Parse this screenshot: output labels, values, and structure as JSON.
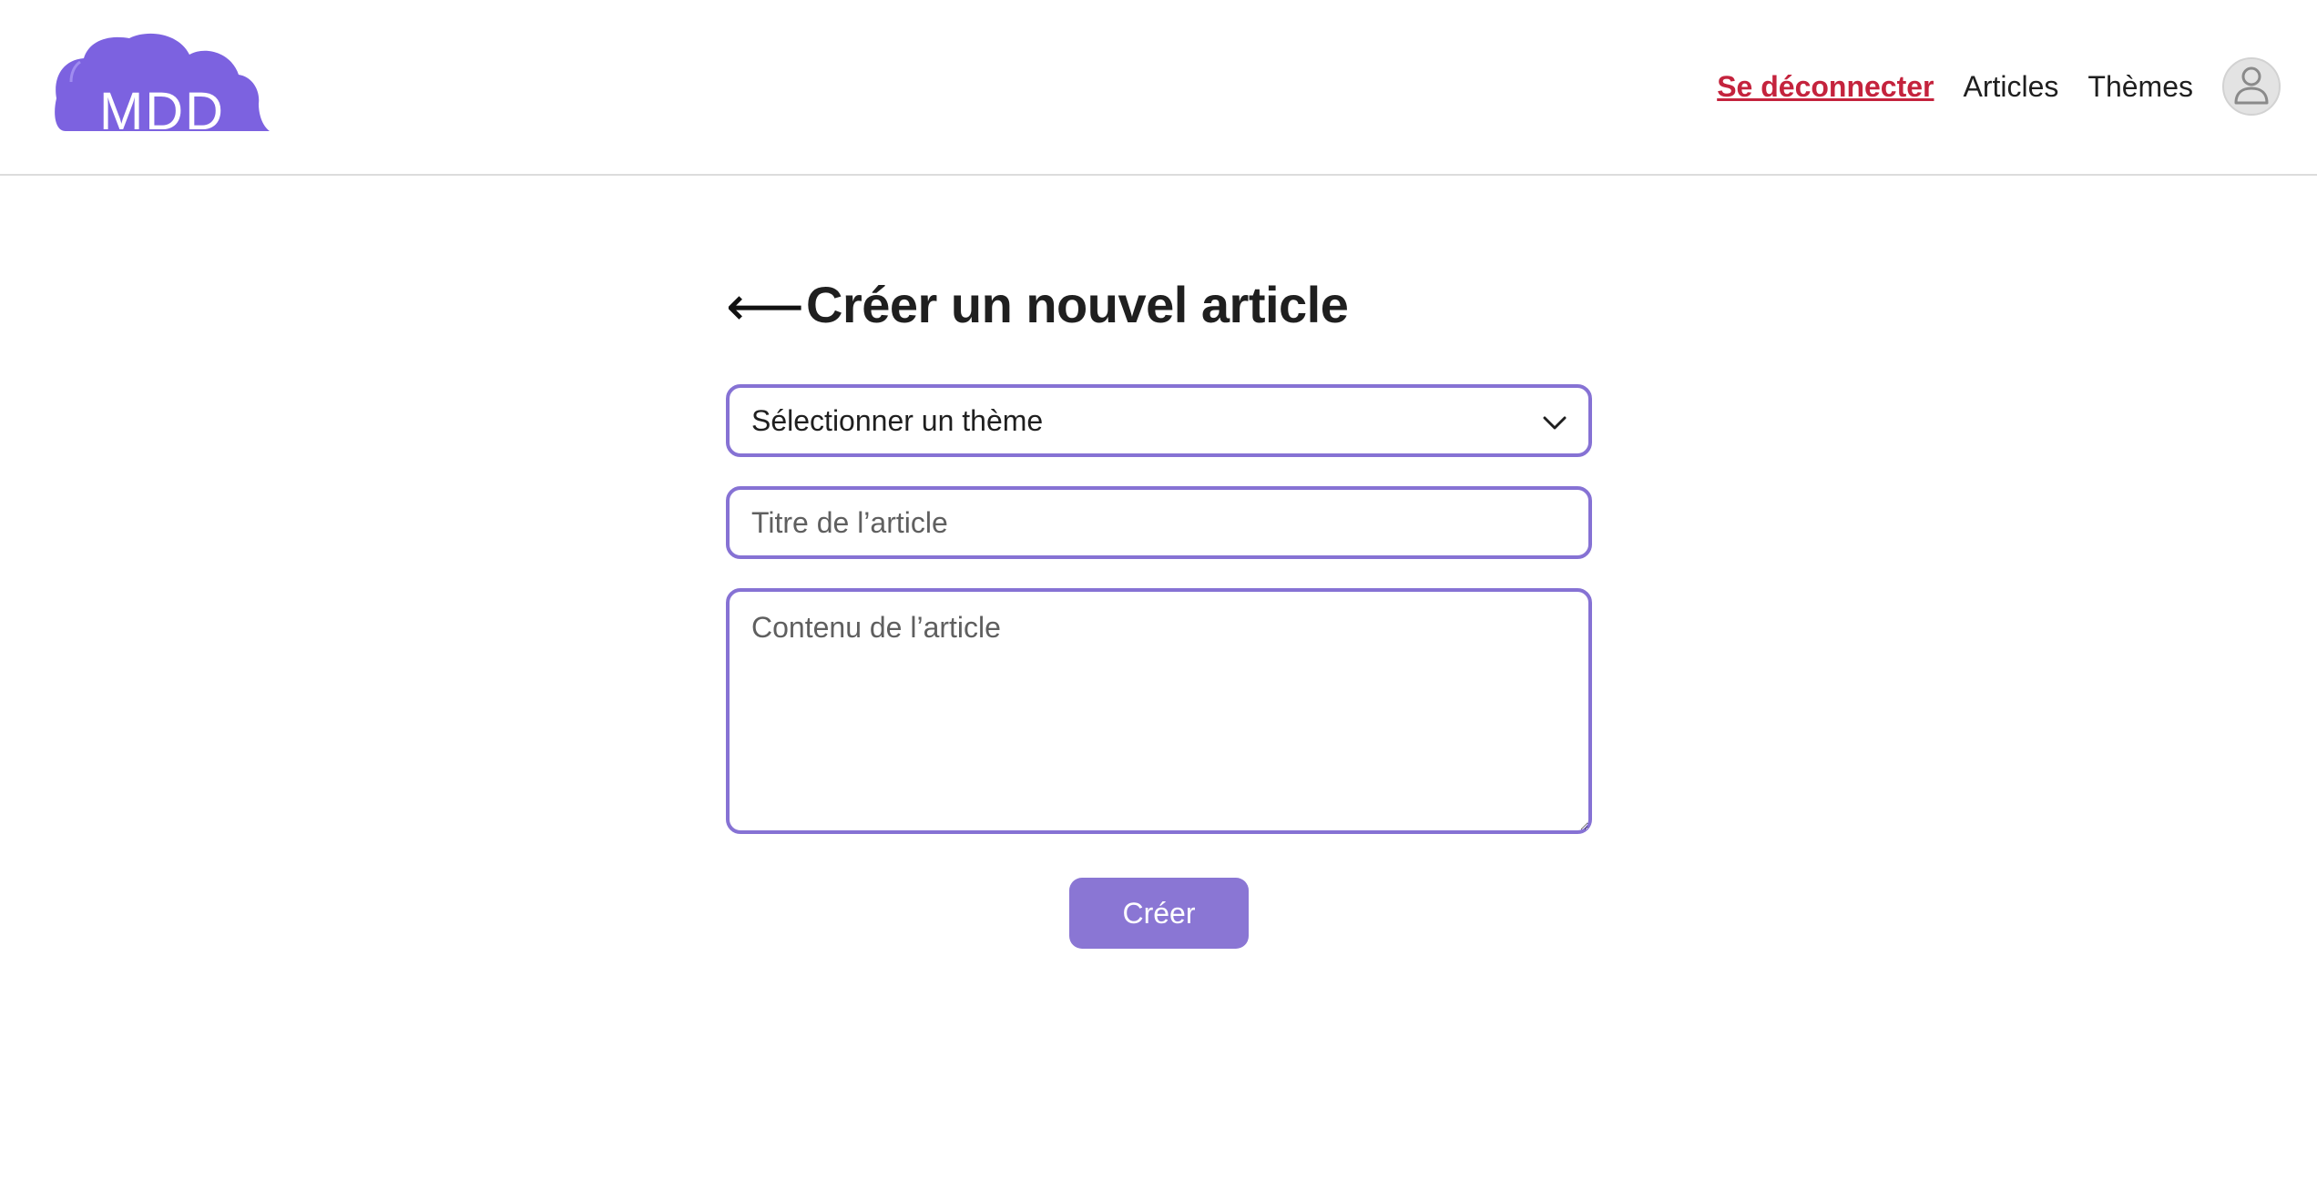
{
  "app": {
    "logo_text": "MDD",
    "brand_color": "#7c62e0"
  },
  "nav": {
    "logout_label": "Se déconnecter",
    "articles_label": "Articles",
    "themes_label": "Thèmes",
    "profile_icon": "user-icon"
  },
  "form": {
    "back_icon": "back-arrow-icon",
    "back_glyph": "⟵",
    "title": "Créer un nouvel article",
    "theme_select": {
      "selected": "Sélectionner un thème",
      "icon": "chevron-down-icon"
    },
    "title_field": {
      "value": "",
      "placeholder": "Titre de l’article"
    },
    "content_field": {
      "value": "",
      "placeholder": "Contenu de l’article"
    },
    "submit_label": "Créer"
  },
  "colors": {
    "accent": "#8672d4",
    "button": "#8a76d4",
    "logout": "#c4233d"
  }
}
